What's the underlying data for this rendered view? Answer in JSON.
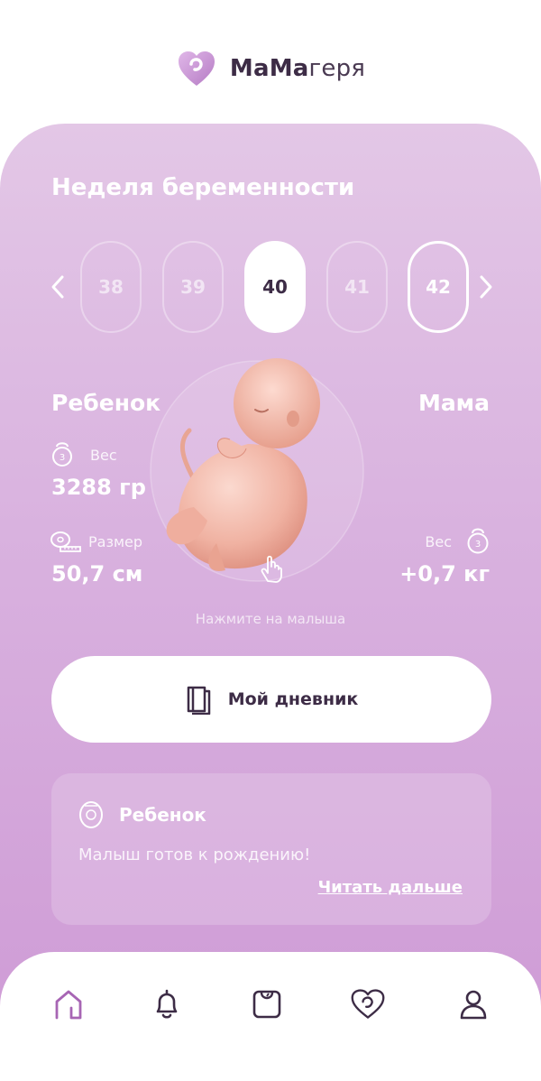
{
  "header": {
    "brand_bold": "МаМа",
    "brand_light": "геря",
    "logo_icon": "heart-logo-icon"
  },
  "weeks": {
    "title": "Неделя беременности",
    "items": [
      "38",
      "39",
      "40",
      "41",
      "42"
    ],
    "selected": "40",
    "outlined": "42"
  },
  "child": {
    "title": "Ребенок",
    "weight_label": "Вес",
    "weight_value": "3288 гр",
    "size_label": "Размер",
    "size_value": "50,7 см"
  },
  "mom": {
    "title": "Мама",
    "weight_label": "Вес",
    "weight_value": "+0,7 кг"
  },
  "baby": {
    "hint": "Нажмите на малыша"
  },
  "diary": {
    "label": "Мой дневник",
    "icon": "book-icon"
  },
  "info": {
    "title": "Ребенок",
    "text": "Малыш готов к рождению!",
    "link": "Читать дальше",
    "icon": "measure-tape-icon"
  },
  "nav": {
    "items": [
      "home-icon",
      "bell-icon",
      "scale-icon",
      "heart-icon",
      "profile-icon"
    ]
  },
  "colors": {
    "accent": "#cf9cd6",
    "dark": "#3d2c46",
    "active_nav": "#a765b4"
  }
}
